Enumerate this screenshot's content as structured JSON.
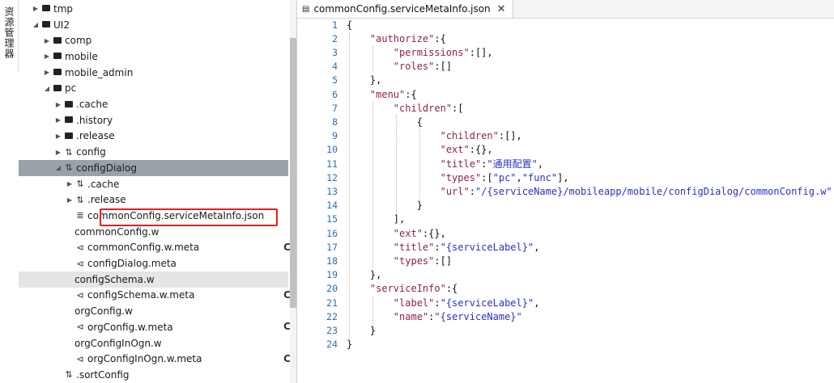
{
  "side_tab": {
    "label": "资源管理器"
  },
  "tree": [
    {
      "label": "tmp",
      "arrow": "▶",
      "icon": "folder",
      "indent": 0
    },
    {
      "label": "UI2",
      "arrow": "◢",
      "icon": "folder",
      "indent": 0
    },
    {
      "label": "comp",
      "arrow": "▶",
      "icon": "folder",
      "indent": 1
    },
    {
      "label": "mobile",
      "arrow": "▶",
      "icon": "folder",
      "indent": 1
    },
    {
      "label": "mobile_admin",
      "arrow": "▶",
      "icon": "folder",
      "indent": 1
    },
    {
      "label": "pc",
      "arrow": "◢",
      "icon": "folder",
      "indent": 1
    },
    {
      "label": ".cache",
      "arrow": "▶",
      "icon": "folder",
      "indent": 2
    },
    {
      "label": ".history",
      "arrow": "▶",
      "icon": "folder",
      "indent": 2
    },
    {
      "label": ".release",
      "arrow": "▶",
      "icon": "folder",
      "indent": 2
    },
    {
      "label": "config",
      "arrow": "▶",
      "icon": "sliders",
      "indent": 2
    },
    {
      "label": "configDialog",
      "arrow": "◢",
      "icon": "sliders",
      "indent": 2,
      "selected": "dark"
    },
    {
      "label": ".cache",
      "arrow": "▶",
      "icon": "sliders",
      "indent": 3
    },
    {
      "label": ".release",
      "arrow": "▶",
      "icon": "sliders",
      "indent": 3
    },
    {
      "label": "commonConfig.serviceMetaInfo.json",
      "arrow": "",
      "icon": "json",
      "indent": 3
    },
    {
      "label": "commonConfig.w",
      "arrow": "",
      "icon": "code",
      "indent": 3
    },
    {
      "label": "commonConfig.w.meta",
      "arrow": "",
      "icon": "meta",
      "indent": 3
    },
    {
      "label": "configDialog.meta",
      "arrow": "",
      "icon": "meta",
      "indent": 3
    },
    {
      "label": "configSchema.w",
      "arrow": "",
      "icon": "code",
      "indent": 3,
      "selected": "light"
    },
    {
      "label": "configSchema.w.meta",
      "arrow": "",
      "icon": "meta",
      "indent": 3
    },
    {
      "label": "orgConfig.w",
      "arrow": "",
      "icon": "code",
      "indent": 3
    },
    {
      "label": "orgConfig.w.meta",
      "arrow": "",
      "icon": "meta",
      "indent": 3
    },
    {
      "label": "orgConfigInOgn.w",
      "arrow": "",
      "icon": "code",
      "indent": 3
    },
    {
      "label": "orgConfigInOgn.w.meta",
      "arrow": "",
      "icon": "meta",
      "indent": 3
    },
    {
      "label": ".sortConfig",
      "arrow": "",
      "icon": "sliders",
      "indent": 2
    }
  ],
  "editor": {
    "tab_title": "commonConfig.serviceMetaInfo.json",
    "close_glyph": "✕",
    "lines": [
      [
        [
          "p",
          "{"
        ]
      ],
      [
        [
          "p",
          "    "
        ],
        [
          "k",
          "\"authorize\""
        ],
        [
          "p",
          ":{"
        ]
      ],
      [
        [
          "p",
          "        "
        ],
        [
          "k",
          "\"permissions\""
        ],
        [
          "p",
          ":[],"
        ]
      ],
      [
        [
          "p",
          "        "
        ],
        [
          "k",
          "\"roles\""
        ],
        [
          "p",
          ":[]"
        ]
      ],
      [
        [
          "p",
          "    },"
        ]
      ],
      [
        [
          "p",
          "    "
        ],
        [
          "k",
          "\"menu\""
        ],
        [
          "p",
          ":{"
        ]
      ],
      [
        [
          "p",
          "        "
        ],
        [
          "k",
          "\"children\""
        ],
        [
          "p",
          ":["
        ]
      ],
      [
        [
          "p",
          "            {"
        ]
      ],
      [
        [
          "p",
          "                "
        ],
        [
          "k",
          "\"children\""
        ],
        [
          "p",
          ":[],"
        ]
      ],
      [
        [
          "p",
          "                "
        ],
        [
          "k",
          "\"ext\""
        ],
        [
          "p",
          ":{},"
        ]
      ],
      [
        [
          "p",
          "                "
        ],
        [
          "k",
          "\"title\""
        ],
        [
          "p",
          ":"
        ],
        [
          "s",
          "\"通用配置\""
        ],
        [
          "p",
          ","
        ]
      ],
      [
        [
          "p",
          "                "
        ],
        [
          "k",
          "\"types\""
        ],
        [
          "p",
          ":["
        ],
        [
          "s",
          "\"pc\""
        ],
        [
          "p",
          ","
        ],
        [
          "s",
          "\"func\""
        ],
        [
          "p",
          "],"
        ]
      ],
      [
        [
          "p",
          "                "
        ],
        [
          "k",
          "\"url\""
        ],
        [
          "p",
          ":"
        ],
        [
          "s",
          "\"/{serviceName}/mobileapp/mobile/configDialog/commonConfig.w\""
        ]
      ],
      [
        [
          "p",
          "            }"
        ]
      ],
      [
        [
          "p",
          "        ],"
        ]
      ],
      [
        [
          "p",
          "        "
        ],
        [
          "k",
          "\"ext\""
        ],
        [
          "p",
          ":{},"
        ]
      ],
      [
        [
          "p",
          "        "
        ],
        [
          "k",
          "\"title\""
        ],
        [
          "p",
          ":"
        ],
        [
          "s",
          "\"{serviceLabel}\""
        ],
        [
          "p",
          ","
        ]
      ],
      [
        [
          "p",
          "        "
        ],
        [
          "k",
          "\"types\""
        ],
        [
          "p",
          ":[]"
        ]
      ],
      [
        [
          "p",
          "    },"
        ]
      ],
      [
        [
          "p",
          "    "
        ],
        [
          "k",
          "\"serviceInfo\""
        ],
        [
          "p",
          ":{"
        ]
      ],
      [
        [
          "p",
          "        "
        ],
        [
          "k",
          "\"label\""
        ],
        [
          "p",
          ":"
        ],
        [
          "s",
          "\"{serviceLabel}\""
        ],
        [
          "p",
          ","
        ]
      ],
      [
        [
          "p",
          "        "
        ],
        [
          "k",
          "\"name\""
        ],
        [
          "p",
          ":"
        ],
        [
          "s",
          "\"{serviceName}\""
        ]
      ],
      [
        [
          "p",
          "    }"
        ]
      ],
      [
        [
          "p",
          "}"
        ]
      ]
    ]
  },
  "colors": {
    "highlight_box": "#e02020",
    "selected_dark": "#9aa2a8",
    "selected_light": "#e3e5e7"
  }
}
